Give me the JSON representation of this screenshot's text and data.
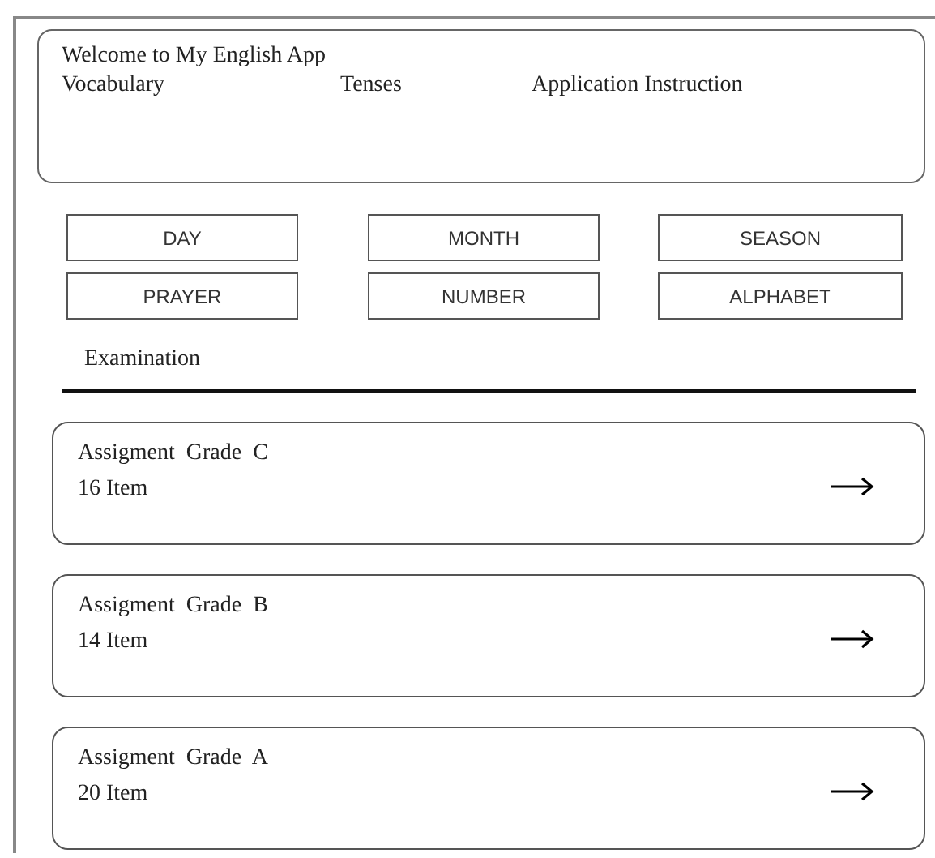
{
  "header": {
    "title": "Welcome to My English App",
    "menu": [
      "Vocabulary",
      "Tenses",
      "Application Instruction"
    ]
  },
  "categories": [
    "DAY",
    "MONTH",
    "SEASON",
    "PRAYER",
    "NUMBER",
    "ALPHABET"
  ],
  "section_title": "Examination",
  "assignments": [
    {
      "title": "Assigment  Grade  C",
      "count": "16 Item"
    },
    {
      "title": "Assigment  Grade  B",
      "count": "14 Item"
    },
    {
      "title": "Assigment  Grade  A",
      "count": "20 Item"
    }
  ]
}
